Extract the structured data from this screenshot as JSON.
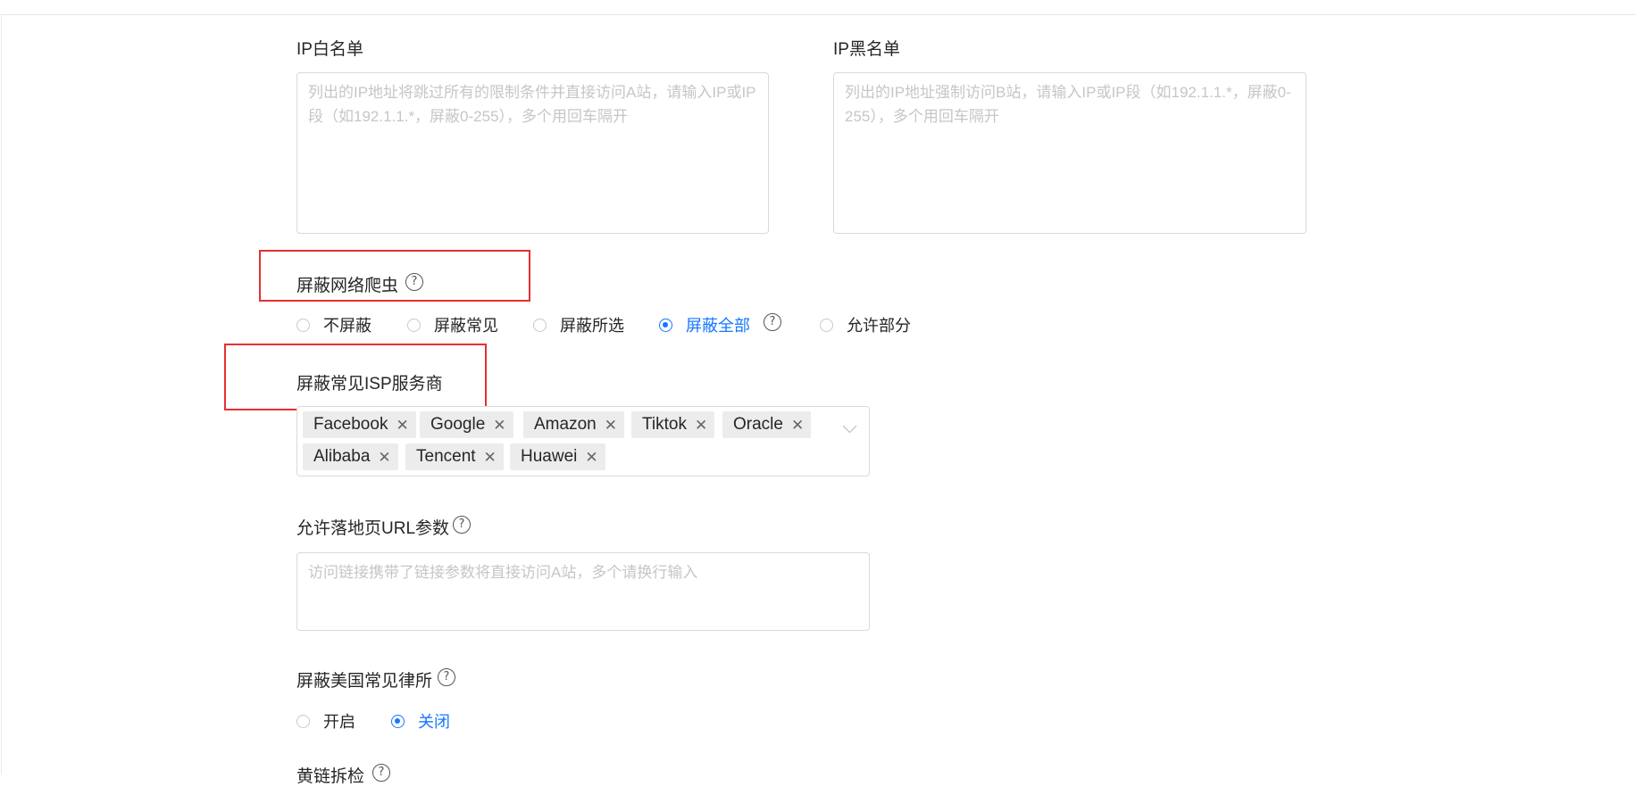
{
  "ip_whitelist": {
    "label": "IP白名单",
    "placeholder": "列出的IP地址将跳过所有的限制条件并直接访问A站，请输入IP或IP段（如192.1.1.*，屏蔽0-255），多个用回车隔开",
    "value": ""
  },
  "ip_blacklist": {
    "label": "IP黑名单",
    "placeholder": "列出的IP地址强制访问B站，请输入IP或IP段（如192.1.1.*，屏蔽0-255），多个用回车隔开",
    "value": ""
  },
  "block_crawler": {
    "label": "屏蔽网络爬虫",
    "help_icon": "question-circle-icon",
    "options": [
      {
        "label": "不屏蔽",
        "checked": false
      },
      {
        "label": "屏蔽常见",
        "checked": false
      },
      {
        "label": "屏蔽所选",
        "checked": false
      },
      {
        "label": "屏蔽全部",
        "checked": true
      },
      {
        "label": "允许部分",
        "checked": false
      }
    ]
  },
  "block_isp": {
    "label": "屏蔽常见ISP服务商",
    "tags": [
      "Facebook",
      "Google",
      "Amazon",
      "Tiktok",
      "Oracle",
      "Alibaba",
      "Tencent",
      "Huawei"
    ],
    "tag_close_glyph": "✕",
    "dropdown_icon": "chevron-down-icon"
  },
  "allow_url_params": {
    "label": "允许落地页URL参数",
    "placeholder": "访问链接携带了链接参数将直接访问A站，多个请换行输入",
    "value": ""
  },
  "block_us_law_firms": {
    "label": "屏蔽美国常见律所",
    "options": [
      {
        "label": "开启",
        "checked": false
      },
      {
        "label": "关闭",
        "checked": true
      }
    ]
  },
  "next_section": {
    "label": "黄链拆检"
  },
  "colors": {
    "primary": "#1677ff",
    "highlight_box": "#e5302f",
    "placeholder": "#c6c6c6",
    "border": "#d9d9d9",
    "tag_bg": "#ececec"
  },
  "help_glyph": "?"
}
